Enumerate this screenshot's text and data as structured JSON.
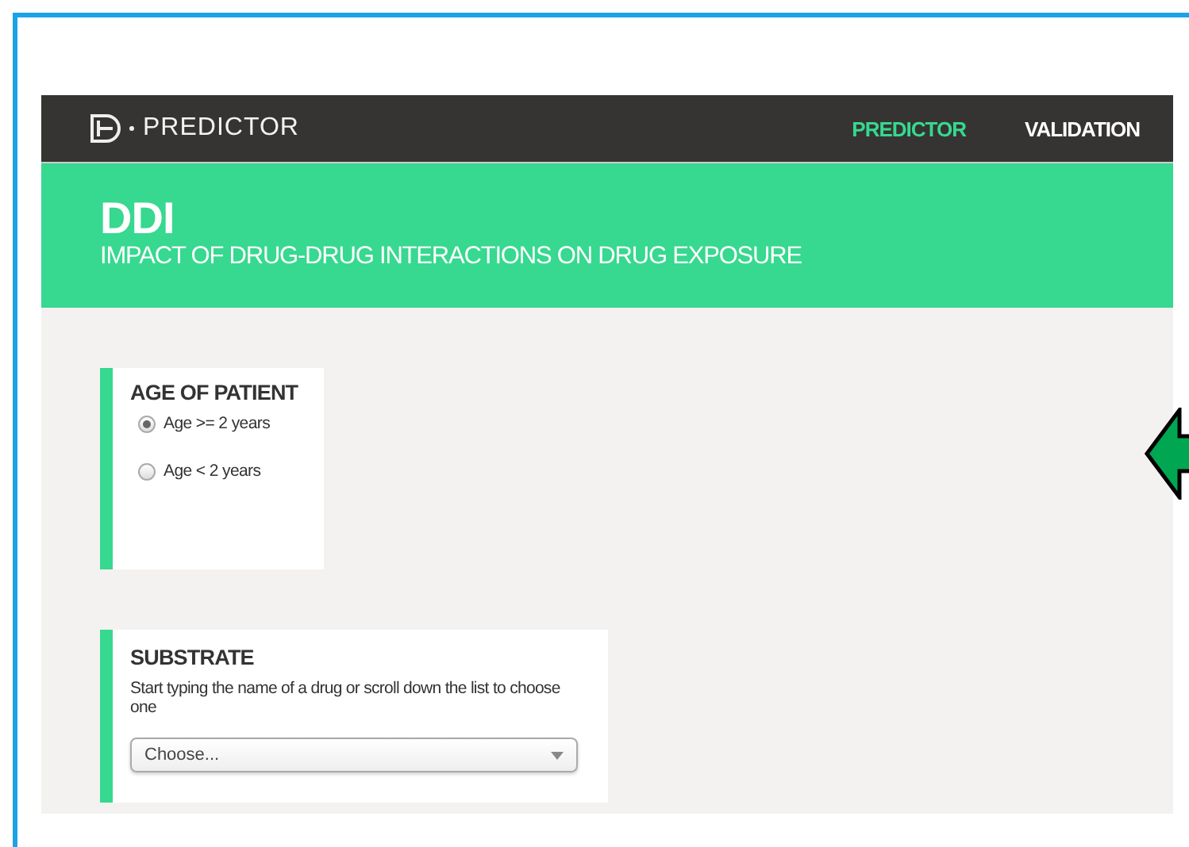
{
  "header": {
    "logo_text": "PREDICTOR",
    "nav": [
      {
        "label": "PREDICTOR",
        "selected": true
      },
      {
        "label": "VALIDATION",
        "selected": false
      }
    ]
  },
  "banner": {
    "title": "DDI",
    "subtitle": "IMPACT OF DRUG-DRUG INTERACTIONS ON DRUG EXPOSURE"
  },
  "sections": [
    {
      "kind": "radio",
      "title": "AGE OF PATIENT",
      "options": [
        {
          "label": "Age >= 2 years",
          "selected": true
        },
        {
          "label": "Age < 2 years",
          "selected": false
        }
      ]
    },
    {
      "kind": "select",
      "title": "SUBSTRATE",
      "hint": "Start typing the name of a drug or scroll down the list to choose one",
      "placeholder": "Choose..."
    }
  ]
}
